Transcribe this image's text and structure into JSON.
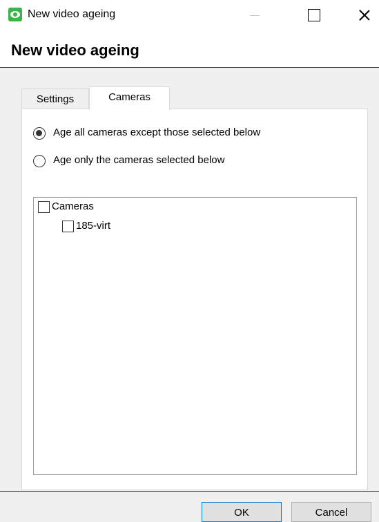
{
  "window": {
    "title": "New video ageing",
    "app_icon": "eye-icon",
    "controls": [
      "minimize-icon",
      "maximize-icon",
      "close-icon"
    ]
  },
  "header": {
    "title": "New video ageing"
  },
  "tabs": [
    {
      "label": "Settings",
      "active": false
    },
    {
      "label": "Cameras",
      "active": true
    }
  ],
  "cameras_tab": {
    "options": [
      {
        "label": "Age all cameras except those selected below",
        "checked": true
      },
      {
        "label": "Age only the cameras selected below",
        "checked": false
      }
    ],
    "tree": {
      "root": {
        "label": "Cameras",
        "checked": false
      },
      "children": [
        {
          "label": "185-virt",
          "checked": false
        }
      ]
    }
  },
  "footer": {
    "ok_label": "OK",
    "cancel_label": "Cancel"
  },
  "colors": {
    "accent": "#3cb44b",
    "focus_border": "#0078d7"
  }
}
